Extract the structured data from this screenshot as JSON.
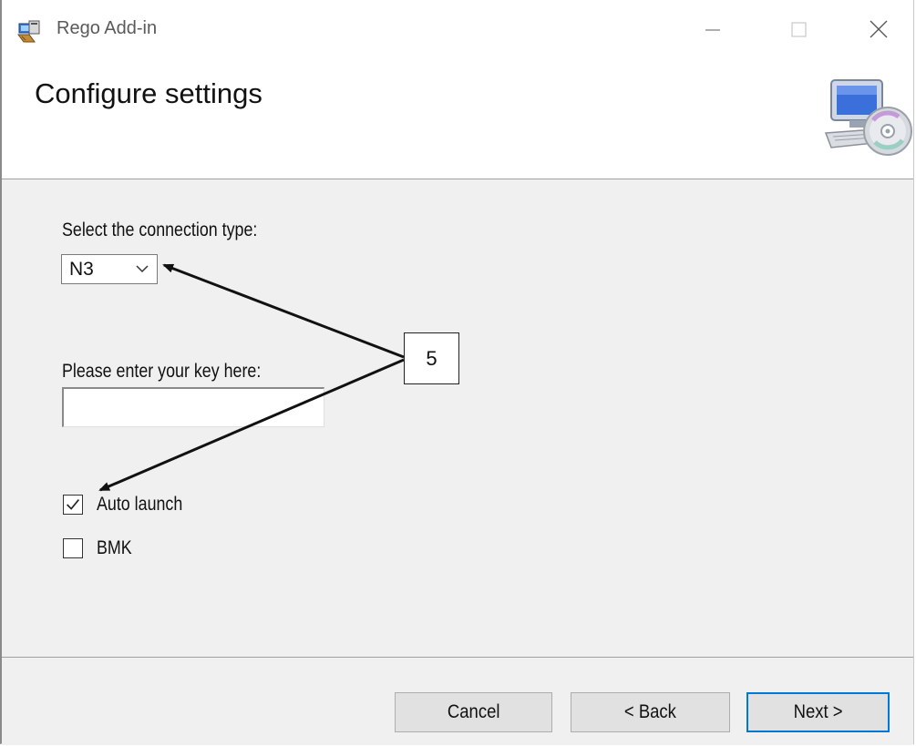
{
  "window": {
    "title": "Rego Add-in",
    "app_icon": "installer-icon",
    "controls": [
      "minimize-icon",
      "maximize-icon",
      "close-icon"
    ]
  },
  "header": {
    "title": "Configure settings",
    "icon": "computer-cd-icon"
  },
  "form": {
    "connection_label": "Select the connection type:",
    "connection_value": "N3",
    "key_label": "Please enter your key here:",
    "key_value": "",
    "checkboxes": [
      {
        "label": "Auto launch",
        "checked": true
      },
      {
        "label": "BMK",
        "checked": false
      }
    ]
  },
  "footer": {
    "cancel_label": "Cancel",
    "back_label": "< Back",
    "next_label": "Next >"
  },
  "annotation": {
    "callout_number": "5"
  },
  "colors": {
    "dialog_bg": "#f0f0f0",
    "banner_bg": "#ffffff",
    "default_button_border": "#0078d7",
    "button_bg": "#e1e1e1"
  }
}
